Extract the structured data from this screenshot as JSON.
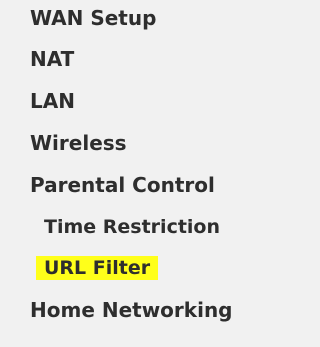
{
  "menu": {
    "highlight_color": "#ffff1a",
    "active_item": "URL Filter",
    "items": [
      {
        "label": "WAN Setup"
      },
      {
        "label": "NAT"
      },
      {
        "label": "LAN"
      },
      {
        "label": "Wireless"
      },
      {
        "label": "Parental Control"
      },
      {
        "label": "Time Restriction"
      },
      {
        "label": "URL Filter"
      },
      {
        "label": "Home Networking"
      }
    ]
  }
}
